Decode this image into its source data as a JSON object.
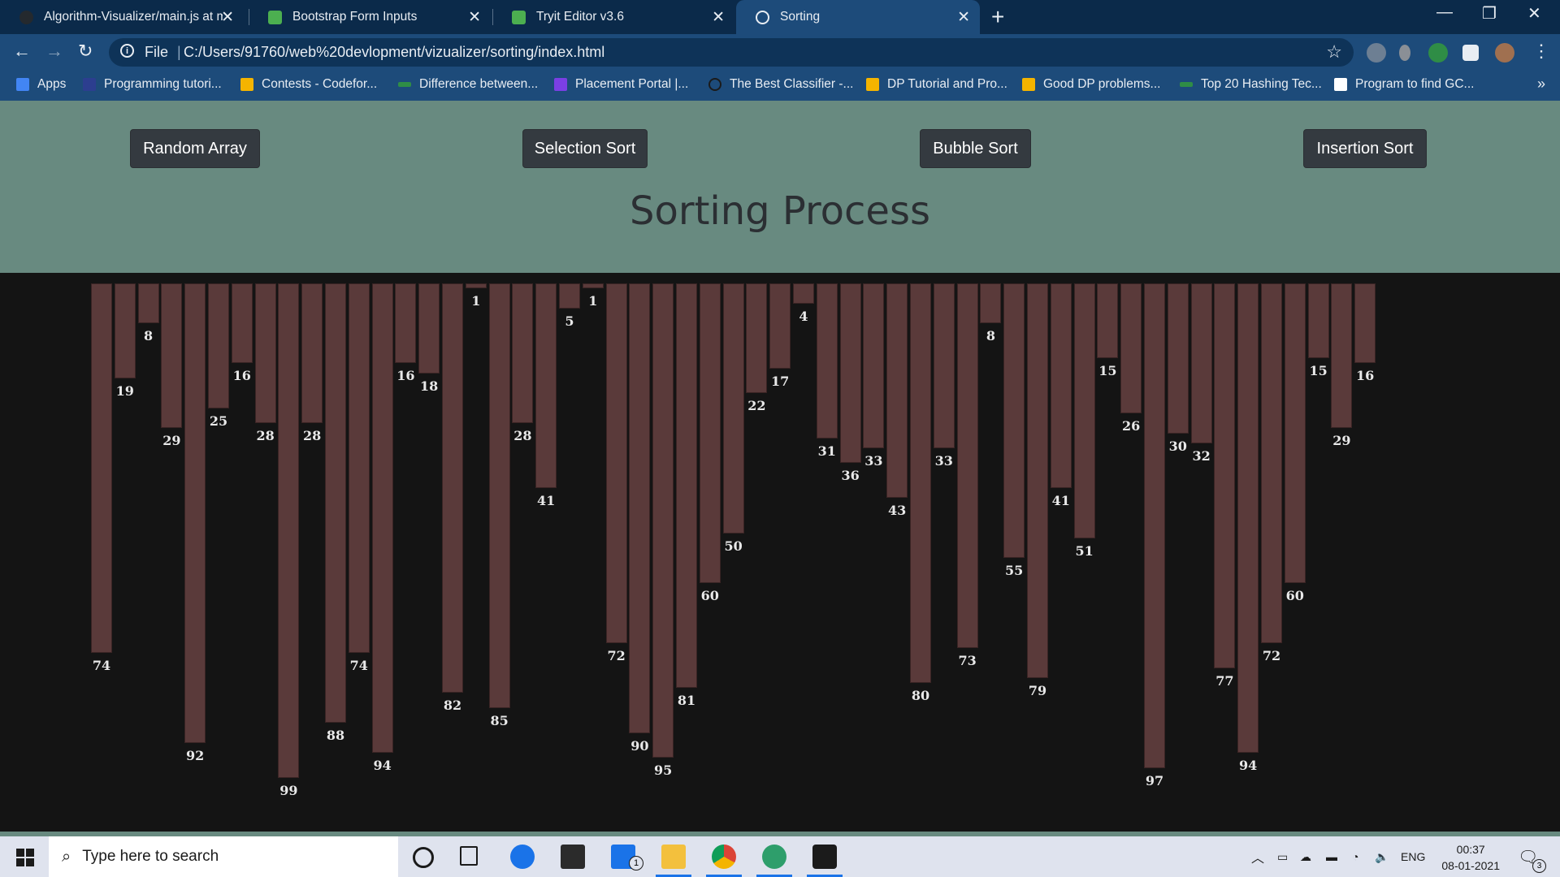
{
  "browser": {
    "tabs": [
      {
        "title": "Algorithm-Visualizer/main.js at m",
        "favicon_color": "#24292e",
        "active": false
      },
      {
        "title": "Bootstrap Form Inputs",
        "favicon_color": "#4caf50",
        "active": false
      },
      {
        "title": "Tryit Editor v3.6",
        "favicon_color": "#4caf50",
        "active": false
      },
      {
        "title": "Sorting",
        "favicon_color": "#e8edf3",
        "active": true
      }
    ],
    "address": {
      "scheme_label": "File",
      "url": "C:/Users/91760/web%20devlopment/vizualizer/sorting/index.html"
    },
    "bookmarks": [
      {
        "label": "Apps",
        "icon_color": "#4285f4"
      },
      {
        "label": "Programming tutori...",
        "icon_color": "#2c3e8f"
      },
      {
        "label": "Contests - Codefor...",
        "icon_color": "#f4b400"
      },
      {
        "label": "Difference between...",
        "icon_color": "#2f8d46"
      },
      {
        "label": "Placement Portal |...",
        "icon_color": "#7b3fe4"
      },
      {
        "label": "The Best Classifier -...",
        "icon_color": "#1b1b1b"
      },
      {
        "label": "DP Tutorial and Pro...",
        "icon_color": "#f4b400"
      },
      {
        "label": "Good DP problems...",
        "icon_color": "#f4b400"
      },
      {
        "label": "Top 20 Hashing Tec...",
        "icon_color": "#2f8d46"
      },
      {
        "label": "Program to find GC...",
        "icon_color": "#ffffff"
      }
    ]
  },
  "page": {
    "buttons": {
      "random": "Random Array",
      "selection": "Selection Sort",
      "bubble": "Bubble Sort",
      "insertion": "Insertion Sort"
    },
    "title": "Sorting Process",
    "colors": {
      "header_bg": "#688a80",
      "bar_fill": "#5a3a3a",
      "canvas_bg": "#141414"
    }
  },
  "chart_data": {
    "type": "bar",
    "orientation": "hanging-from-top",
    "categories": [],
    "values": [
      74,
      19,
      8,
      29,
      92,
      25,
      16,
      28,
      99,
      28,
      88,
      74,
      94,
      16,
      18,
      82,
      1,
      85,
      28,
      41,
      5,
      1,
      72,
      90,
      95,
      81,
      60,
      50,
      22,
      17,
      4,
      31,
      36,
      33,
      43,
      80,
      33,
      73,
      8,
      55,
      79,
      41,
      51,
      15,
      26,
      97,
      30,
      32,
      77,
      94,
      72,
      60,
      15,
      29,
      16
    ],
    "ylim": [
      0,
      100
    ],
    "data_labels": true
  },
  "taskbar": {
    "search_placeholder": "Type here to search",
    "language": "ENG",
    "time": "00:37",
    "date": "08-01-2021",
    "mail_badge": "1",
    "notification_badge": "3"
  }
}
